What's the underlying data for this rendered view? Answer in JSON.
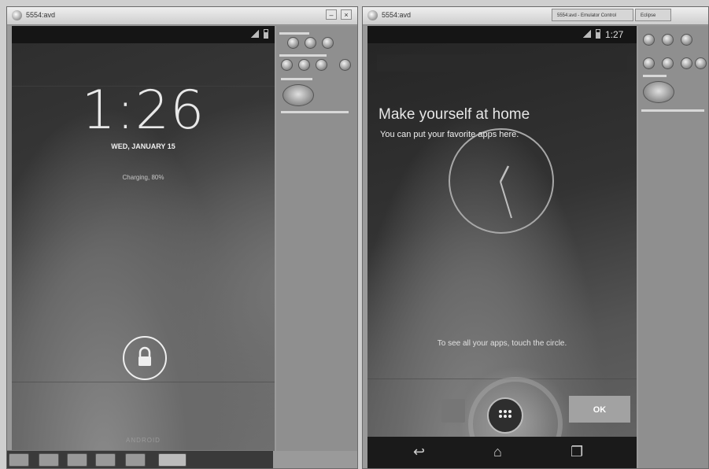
{
  "left_window": {
    "title": "5554:avd",
    "status_bar": {
      "icons": [
        "signal-icon",
        "battery-icon"
      ]
    },
    "lock_screen": {
      "time": "1:26",
      "date": "WED, JANUARY 15",
      "charging": "Charging, 80%",
      "carrier": "ANDROID",
      "lock_icon": "padlock-icon"
    },
    "taskbar_icons": [
      "file-icon",
      "document-icon",
      "browser-icon",
      "folder-icon",
      "alert-icon",
      "app-icon"
    ]
  },
  "right_window": {
    "title": "5554:avd",
    "tabs": [
      "5554:avd - Emulator Control",
      "Eclipse"
    ],
    "status_bar": {
      "time": "1:27",
      "icons": [
        "signal-icon",
        "battery-icon"
      ]
    },
    "home_intro": {
      "title": "Make yourself at home",
      "subtitle": "You can put your favorite apps here.",
      "hint": "To see all your apps, touch the circle.",
      "ok_label": "OK"
    },
    "nav_icons": [
      "back-icon",
      "home-icon",
      "recents-icon"
    ]
  },
  "colors": {
    "screen_dark": "#222222",
    "panel_gray": "#8f8f8f",
    "ok_button": "#a2a2a2"
  }
}
